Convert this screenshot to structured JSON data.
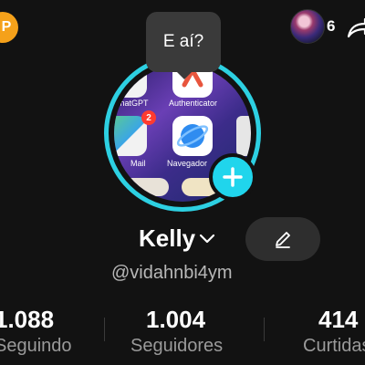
{
  "header": {
    "coin_symbol": "P",
    "friend_count": "6"
  },
  "bubble": {
    "text": "E aí?"
  },
  "avatar": {
    "apps": [
      {
        "label": "ChatGPT"
      },
      {
        "label": "Authenticator"
      },
      {
        "label": "Mail",
        "badge": "2"
      },
      {
        "label": "Navegador"
      }
    ]
  },
  "profile": {
    "name": "Kelly",
    "handle": "@vidahnbi4ym"
  },
  "stats": [
    {
      "value": "1.088",
      "label": "Seguindo"
    },
    {
      "value": "1.004",
      "label": "Seguidores"
    },
    {
      "value": "414",
      "label": "Curtidas"
    }
  ],
  "colors": {
    "background": "#121212",
    "ring": "#2dd0e2",
    "add_button": "#20d5ec",
    "coin": "#f5a11a"
  }
}
